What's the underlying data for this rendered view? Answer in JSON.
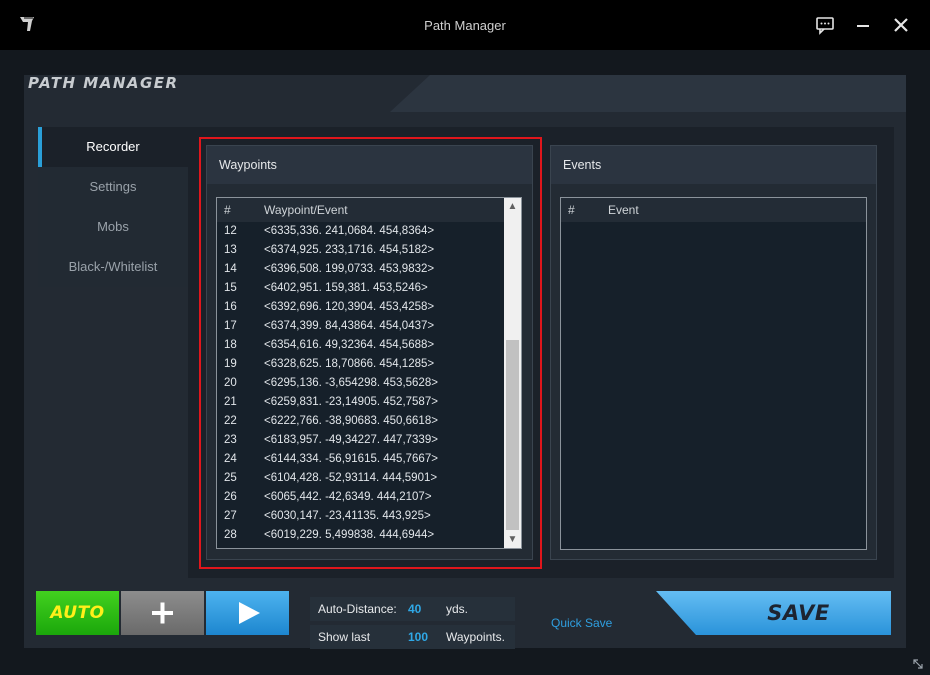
{
  "window": {
    "title": "Path Manager"
  },
  "header": {
    "title": "PATH MANAGER"
  },
  "nav": {
    "items": [
      {
        "label": "Recorder",
        "active": true
      },
      {
        "label": "Settings",
        "active": false
      },
      {
        "label": "Mobs",
        "active": false
      },
      {
        "label": "Black-/Whitelist",
        "active": false
      }
    ]
  },
  "waypoints": {
    "title": "Waypoints",
    "col_index": "#",
    "col_value": "Waypoint/Event",
    "rows": [
      {
        "index": "12",
        "value": "<6335,336. 241,0684. 454,8364>"
      },
      {
        "index": "13",
        "value": "<6374,925. 233,1716. 454,5182>"
      },
      {
        "index": "14",
        "value": "<6396,508. 199,0733. 453,9832>"
      },
      {
        "index": "15",
        "value": "<6402,951. 159,381. 453,5246>"
      },
      {
        "index": "16",
        "value": "<6392,696. 120,3904. 453,4258>"
      },
      {
        "index": "17",
        "value": "<6374,399. 84,43864. 454,0437>"
      },
      {
        "index": "18",
        "value": "<6354,616. 49,32364. 454,5688>"
      },
      {
        "index": "19",
        "value": "<6328,625. 18,70866. 454,1285>"
      },
      {
        "index": "20",
        "value": "<6295,136. -3,654298. 453,5628>"
      },
      {
        "index": "21",
        "value": "<6259,831. -23,14905. 452,7587>"
      },
      {
        "index": "22",
        "value": "<6222,766. -38,90683. 450,6618>"
      },
      {
        "index": "23",
        "value": "<6183,957. -49,34227. 447,7339>"
      },
      {
        "index": "24",
        "value": "<6144,334. -56,91615. 445,7667>"
      },
      {
        "index": "25",
        "value": "<6104,428. -52,93114. 444,5901>"
      },
      {
        "index": "26",
        "value": "<6065,442. -42,6349. 444,2107>"
      },
      {
        "index": "27",
        "value": "<6030,147. -23,41135. 443,925>"
      },
      {
        "index": "28",
        "value": "<6019,229. 5,499838. 444,6944>"
      }
    ]
  },
  "events": {
    "title": "Events",
    "col_index": "#",
    "col_value": "Event"
  },
  "controls": {
    "auto_label": "AUTO",
    "auto_distance_label": "Auto-Distance:",
    "auto_distance_value": "40",
    "auto_distance_unit": "yds.",
    "show_last_label": "Show last",
    "show_last_value": "100",
    "show_last_unit": "Waypoints.",
    "quick_save_label": "Quick Save",
    "save_label": "SAVE"
  },
  "colors": {
    "accent": "#2a9fd8",
    "auto_green": "#1ba70b",
    "highlight_red": "#e0161c",
    "save_blue": "#2a93da"
  }
}
